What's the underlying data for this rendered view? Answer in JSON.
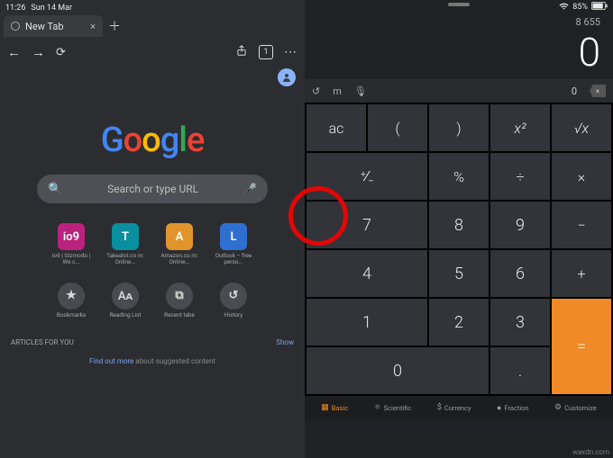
{
  "status": {
    "time": "11:26",
    "date": "Sun 14 Mar",
    "battery": "85%",
    "wifi_icon": "wifi",
    "battery_icon": "battery"
  },
  "chrome": {
    "tab_title": "New Tab",
    "tab_count": "1",
    "search_placeholder": "Search or type URL",
    "google_letters": [
      "G",
      "o",
      "o",
      "g",
      "l",
      "e"
    ],
    "shortcuts": [
      {
        "label": "io9 | Gizmodo | We c...",
        "initial": "io9",
        "color": "c-pink"
      },
      {
        "label": "Takealot.co m: Online...",
        "initial": "T",
        "color": "c-teal"
      },
      {
        "label": "Amazon.co m: Online...",
        "initial": "A",
        "color": "c-amber"
      },
      {
        "label": "Outlook – free perso...",
        "initial": "L",
        "color": "c-blue"
      }
    ],
    "quick_actions": [
      {
        "label": "Bookmarks",
        "glyph": "★"
      },
      {
        "label": "Reading List",
        "glyph": "Aᴀ"
      },
      {
        "label": "Recent tabs",
        "glyph": "⧉"
      },
      {
        "label": "History",
        "glyph": "↺"
      }
    ],
    "articles_label": "ARTICLES FOR YOU",
    "show_label": "Show",
    "find_out_link": "Find out more",
    "find_out_rest": " about suggested content"
  },
  "calc": {
    "history": "8 655",
    "display": "0",
    "input_current": "0",
    "rows": [
      [
        "ac",
        "(",
        ")",
        "x²",
        "√x"
      ],
      [
        "⁺∕₋",
        "%",
        "÷",
        "×"
      ],
      [
        "7",
        "8",
        "9",
        "−"
      ],
      [
        "4",
        "5",
        "6",
        "+"
      ],
      [
        "1",
        "2",
        "3",
        "="
      ],
      [
        "0",
        ".",
        "="
      ]
    ],
    "modes": [
      {
        "label": "Basic",
        "active": true
      },
      {
        "label": "Scientific",
        "active": false
      },
      {
        "label": "Currency",
        "active": false
      },
      {
        "label": "Fraction",
        "active": false
      },
      {
        "label": "Customize",
        "active": false
      }
    ]
  },
  "watermark": "waxdn.com"
}
